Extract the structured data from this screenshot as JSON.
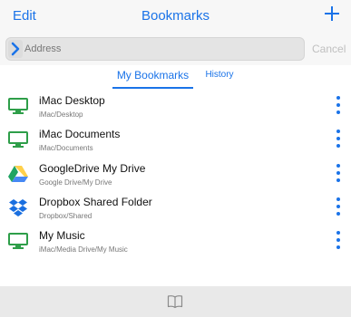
{
  "header": {
    "edit_label": "Edit",
    "title": "Bookmarks",
    "add_icon": "plus-icon"
  },
  "address": {
    "placeholder": "Address",
    "value": "",
    "cancel_label": "Cancel",
    "icon": "chevron-right-icon"
  },
  "tabs": [
    {
      "label": "My Bookmarks",
      "active": true
    },
    {
      "label": "History",
      "active": false
    }
  ],
  "bookmarks": [
    {
      "name": "iMac Desktop",
      "path": "iMac/Desktop",
      "icon": "monitor-icon"
    },
    {
      "name": "iMac Documents",
      "path": "iMac/Documents",
      "icon": "monitor-icon"
    },
    {
      "name": "GoogleDrive My Drive",
      "path": "Google Drive/My Drive",
      "icon": "google-drive-icon"
    },
    {
      "name": "Dropbox Shared Folder",
      "path": "Dropbox/Shared",
      "icon": "dropbox-icon"
    },
    {
      "name": "My Music",
      "path": "iMac/Media Drive/My Music",
      "icon": "monitor-icon"
    }
  ],
  "footer": {
    "icon": "book-icon"
  },
  "colors": {
    "accent": "#1a73e8",
    "monitor": "#2e9e49",
    "dropbox": "#1a6fe0",
    "drive_green": "#1fa463",
    "drive_yellow": "#ffd04b",
    "drive_blue": "#4688f4"
  }
}
